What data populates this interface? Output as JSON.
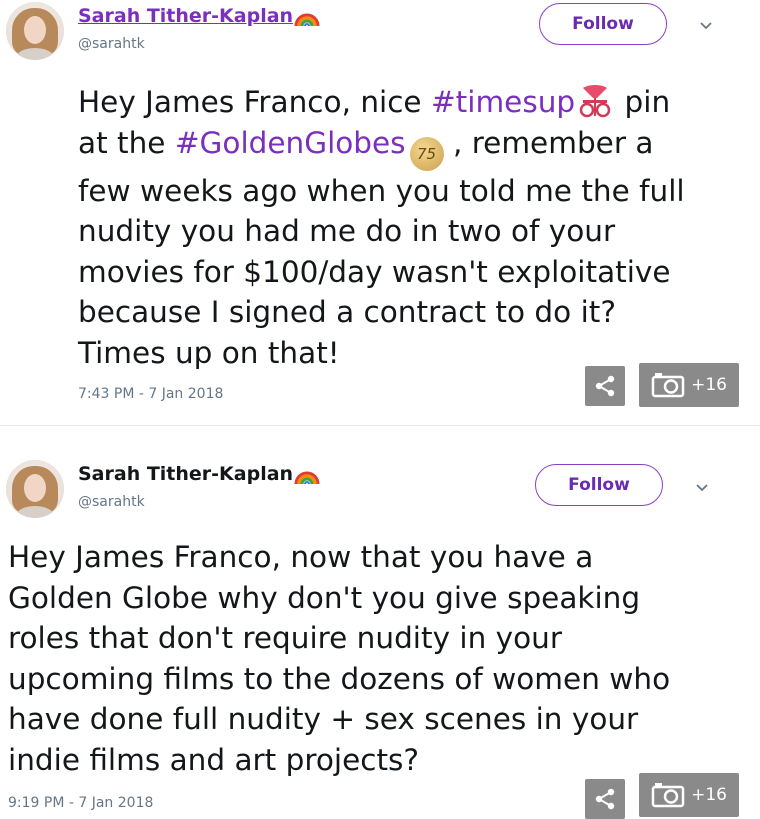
{
  "tweets": [
    {
      "display_name": "Sarah Tither-Kaplan",
      "handle": "@sarahtk",
      "follow_label": "Follow",
      "text_part1": "Hey James Franco, nice ",
      "hashtag1": "#timesup",
      "text_part2": " pin\nat the ",
      "hashtag2": "#GoldenGlobes",
      "text_part3": " , remember a\nfew weeks ago when you told me the full\nnudity you had me do in two of your\nmovies for $100/day wasn't exploitative\nbecause I signed a contract to do it?\nTimes up on that!",
      "timestamp": "7:43 PM - 7 Jan 2018",
      "gallery_count": "+16",
      "emoji_75": "75"
    },
    {
      "display_name": "Sarah Tither-Kaplan",
      "handle": "@sarahtk",
      "follow_label": "Follow",
      "text": "Hey James Franco, now that you have a\nGolden Globe why don't you give speaking\nroles that don't require nudity in your\nupcoming films to the dozens of women who\nhave done full nudity + sex scenes in your\nindie films and art projects?",
      "timestamp": "9:19 PM - 7 Jan 2018",
      "gallery_count": "+16"
    }
  ],
  "icons": {
    "rainbow": "rainbow-emoji-icon",
    "timesup": "timesup-pin-emoji-icon",
    "golden_globes": "golden-globes-75-emoji-icon",
    "share": "share-icon",
    "camera": "camera-icon",
    "chevron": "chevron-down-icon"
  },
  "colors": {
    "accent": "#7b2fbf",
    "secondary_text": "#657786",
    "overlay_button": "#8a8a8a"
  }
}
